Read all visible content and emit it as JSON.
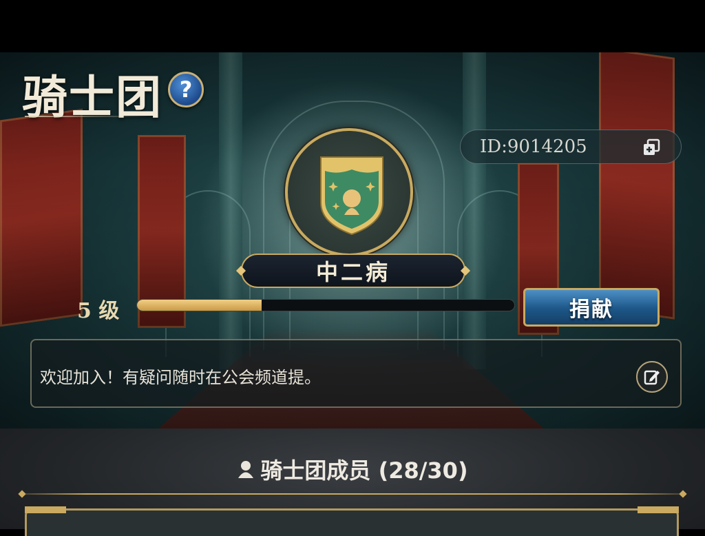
{
  "header": {
    "title": "骑士团",
    "help_label": "?",
    "guild_id": "ID:9014205"
  },
  "guild": {
    "name": "中二病",
    "level_label": "5 级",
    "level_progress": 0.33,
    "donate_label": "捐献",
    "notice": "欢迎加入！有疑问随时在公会频道提。"
  },
  "members": {
    "title": "骑士团成员 (28/30)"
  },
  "colors": {
    "gold": "#c9aa60",
    "emblem_green": "#3e8a63",
    "button_blue": "#1d5687",
    "progress_fill": "#e3b866"
  },
  "icons": {
    "help": "help-icon",
    "copy": "copy-icon",
    "edit": "edit-icon",
    "members": "member-silhouette-icon",
    "emblem": "guild-shield-emblem"
  }
}
